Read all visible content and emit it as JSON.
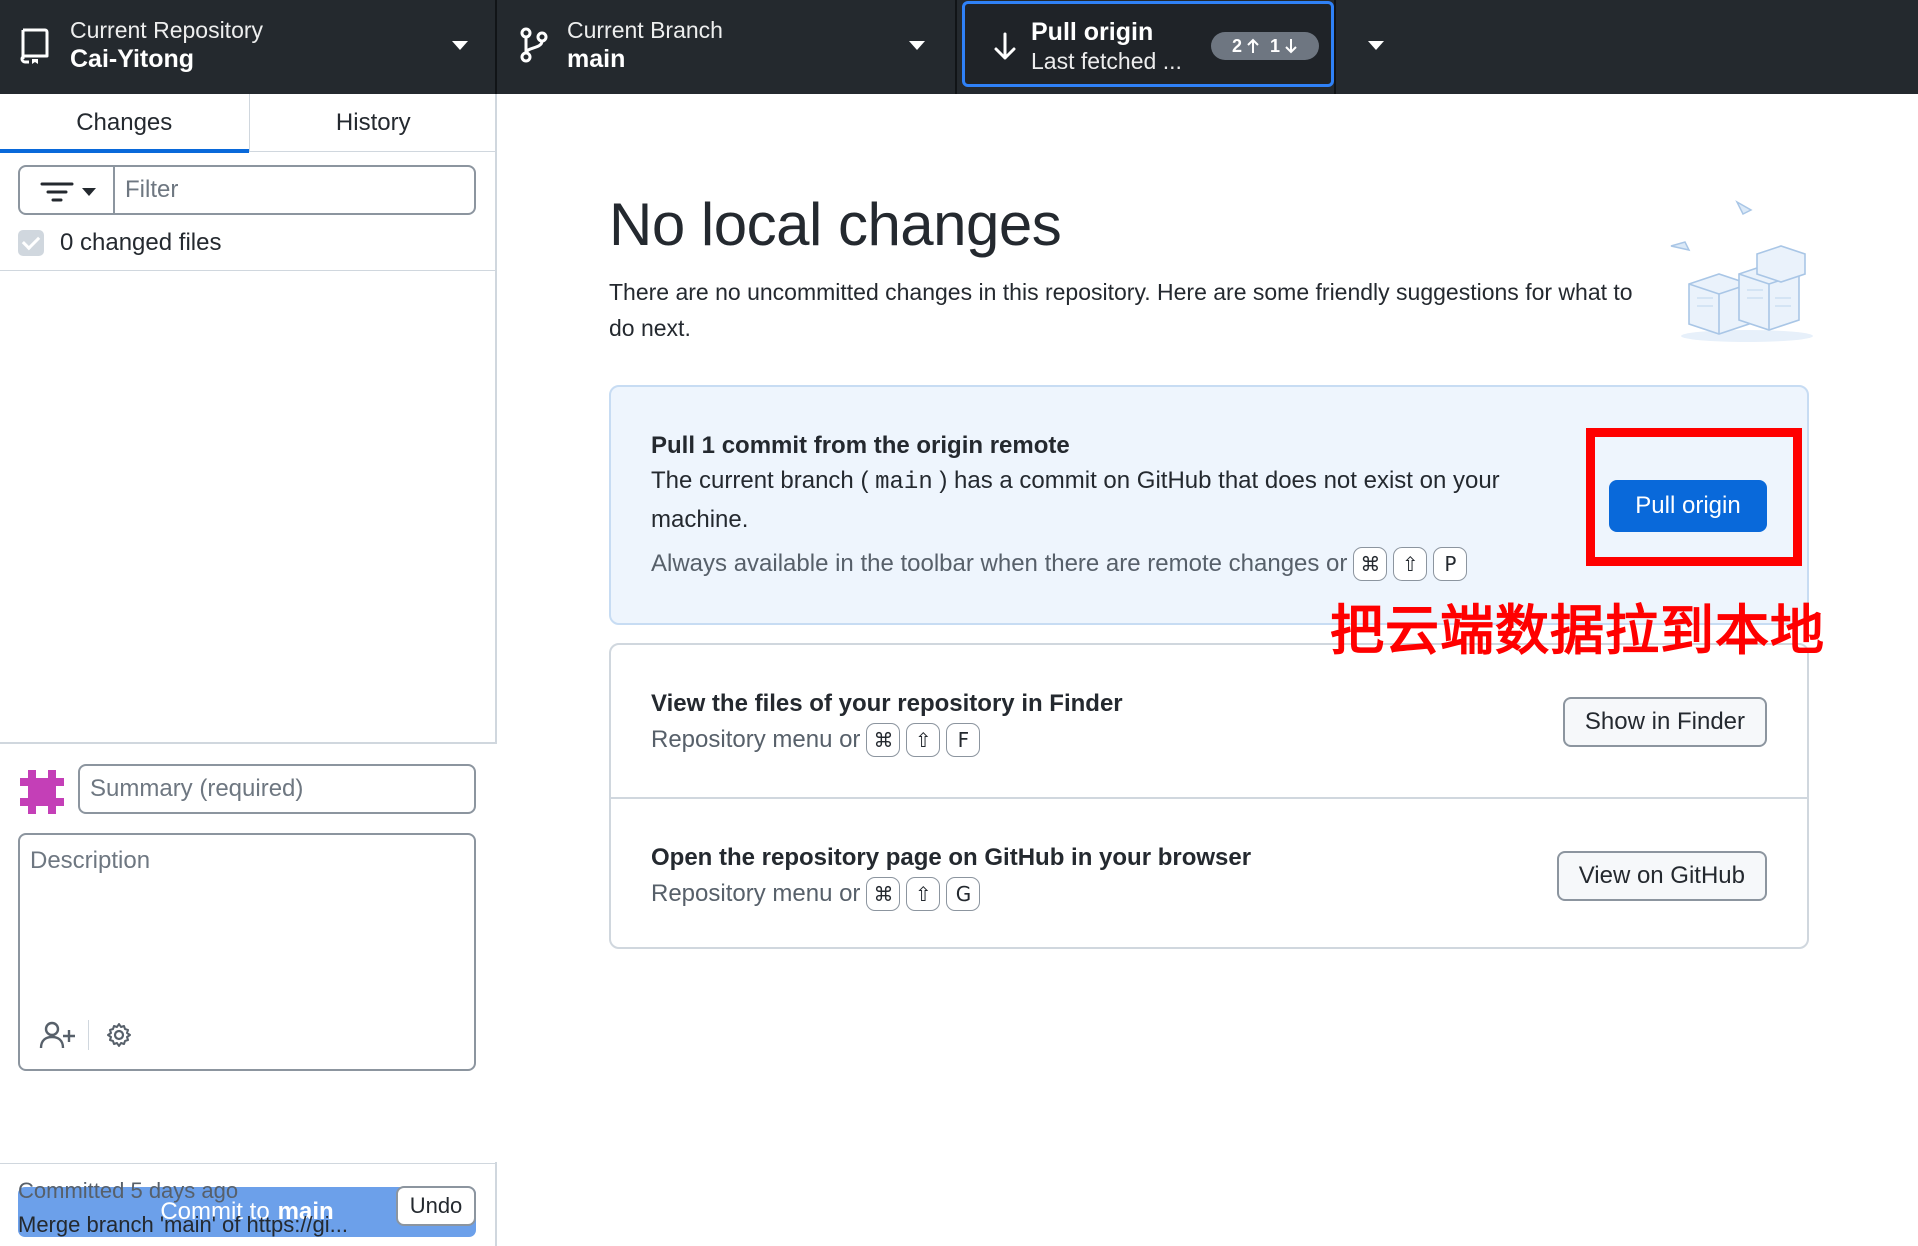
{
  "toolbar": {
    "repository": {
      "label": "Current Repository",
      "value": "Cai-Yitong"
    },
    "branch": {
      "label": "Current Branch",
      "value": "main"
    },
    "pull": {
      "label": "Pull origin",
      "sublabel": "Last fetched ...",
      "ahead": "2",
      "behind": "1"
    }
  },
  "sidebar": {
    "tabs": [
      {
        "label": "Changes",
        "active": true
      },
      {
        "label": "History",
        "active": false
      }
    ],
    "filter_placeholder": "Filter",
    "changed_files": "0 changed files",
    "summary_placeholder": "Summary (required)",
    "description_placeholder": "Description",
    "commit_button": {
      "prefix": "Commit to",
      "branch": "main"
    },
    "last_commit": {
      "when": "Committed 5 days ago",
      "message": "Merge branch 'main' of https://gi...",
      "undo_label": "Undo"
    }
  },
  "main": {
    "title": "No local changes",
    "subtitle": "There are no uncommitted changes in this repository. Here are some friendly suggestions for what to do next.",
    "pull_card": {
      "title": "Pull 1 commit from the origin remote",
      "desc_pre": "The current branch (",
      "desc_code": "main",
      "desc_post": ") has a commit on GitHub that does not exist on your machine.",
      "hint": "Always available in the toolbar when there are remote changes or",
      "keys": [
        "⌘",
        "⇧",
        "P"
      ],
      "button": "Pull origin"
    },
    "finder_card": {
      "title": "View the files of your repository in Finder",
      "hint": "Repository menu or",
      "keys": [
        "⌘",
        "⇧",
        "F"
      ],
      "button": "Show in Finder"
    },
    "github_card": {
      "title": "Open the repository page on GitHub in your browser",
      "hint": "Repository menu or",
      "keys": [
        "⌘",
        "⇧",
        "G"
      ],
      "button": "View on GitHub"
    }
  },
  "annotation": {
    "text": "把云端数据拉到本地",
    "color": "#ff0000"
  },
  "colors": {
    "accent": "#0969da",
    "toolbar": "#24292e",
    "commit_button": "#6ca0ea"
  }
}
